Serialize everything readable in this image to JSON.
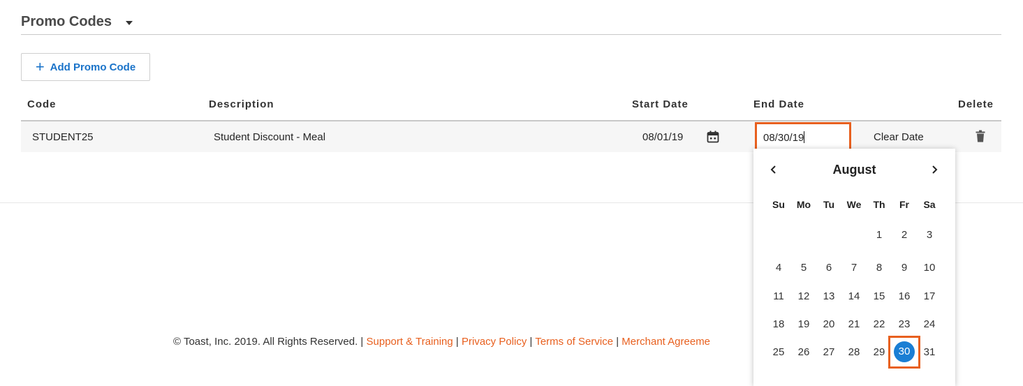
{
  "section": {
    "title": "Promo Codes"
  },
  "add_button": {
    "label": "Add Promo Code"
  },
  "table": {
    "headers": {
      "code": "Code",
      "description": "Description",
      "start_date": "Start Date",
      "end_date": "End Date",
      "delete": "Delete"
    },
    "row": {
      "code": "STUDENT25",
      "description": "Student Discount - Meal",
      "start_date": "08/01/19",
      "end_date": "08/30/19",
      "clear_date": "Clear Date"
    }
  },
  "datepicker": {
    "month": "August",
    "weekdays": [
      "Su",
      "Mo",
      "Tu",
      "We",
      "Th",
      "Fr",
      "Sa"
    ],
    "weeks": [
      [
        "",
        "",
        "",
        "",
        "1",
        "2",
        "3"
      ],
      [
        "4",
        "5",
        "6",
        "7",
        "8",
        "9",
        "10"
      ],
      [
        "11",
        "12",
        "13",
        "14",
        "15",
        "16",
        "17"
      ],
      [
        "18",
        "19",
        "20",
        "21",
        "22",
        "23",
        "24"
      ],
      [
        "25",
        "26",
        "27",
        "28",
        "29",
        "30",
        "31"
      ]
    ],
    "selected": "30",
    "colors": {
      "selected": "#1a7ed4",
      "highlight": "#e8601f"
    }
  },
  "footer": {
    "copyright": "© Toast, Inc. 2019. All Rights Reserved.",
    "sep": "|",
    "links": [
      "Support & Training",
      "Privacy Policy",
      "Terms of Service",
      "Merchant Agreeme"
    ]
  },
  "colors": {
    "link": "#1a73c9",
    "accent": "#e8601f"
  }
}
